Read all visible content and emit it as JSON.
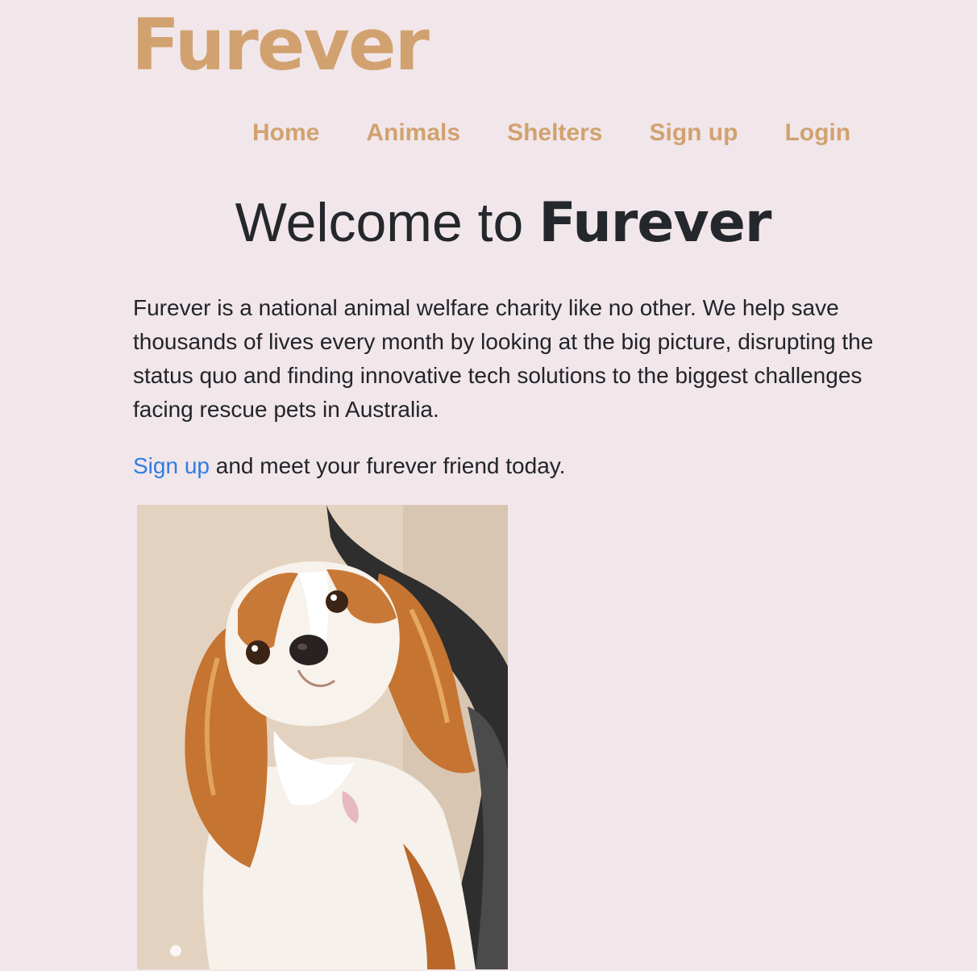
{
  "site": {
    "logo": "Furever"
  },
  "nav": {
    "items": [
      {
        "label": "Home"
      },
      {
        "label": "Animals"
      },
      {
        "label": "Shelters"
      },
      {
        "label": "Sign up"
      },
      {
        "label": "Login"
      }
    ]
  },
  "hero": {
    "heading_prefix": "Welcome to ",
    "heading_brand": "Furever"
  },
  "intro": {
    "text": "Furever is a national animal welfare charity like no other. We help save thousands of lives every month by looking at the big picture, disrupting the status quo and finding innovative tech solutions to the biggest challenges facing rescue pets in Australia."
  },
  "cta": {
    "link_label": "Sign up",
    "rest": " and meet your furever friend today."
  },
  "image": {
    "subject": "cavalier-king-charles-spaniel-photo"
  },
  "colors": {
    "background": "#f1e6ea",
    "brand": "#d1a26f",
    "text": "#212529",
    "link": "#2f7de1"
  }
}
